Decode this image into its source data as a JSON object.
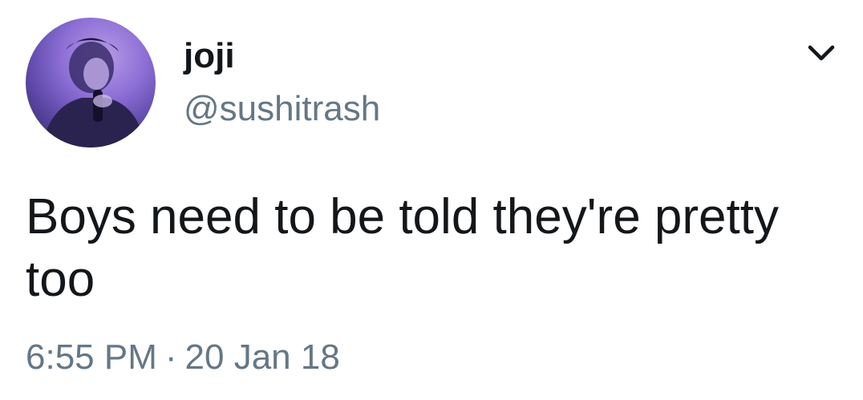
{
  "tweet": {
    "author": {
      "display_name": "joji",
      "handle": "@sushitrash",
      "avatar_icon": "profile-photo"
    },
    "menu_icon": "chevron-down-icon",
    "text": "Boys need to be told they're pretty too",
    "time": "6:55 PM",
    "separator": "·",
    "date": "20 Jan 18"
  },
  "colors": {
    "text_primary": "#14171a",
    "text_secondary": "#657786",
    "avatar_tint": "#8d6fd6"
  }
}
